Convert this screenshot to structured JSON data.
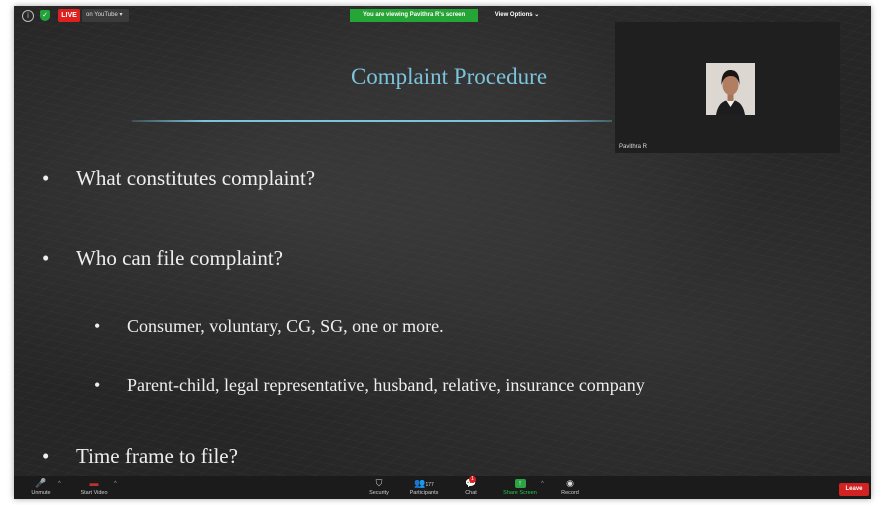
{
  "top_bar": {
    "live_label": "LIVE",
    "youtube_label": "on YouTube ▾",
    "viewing_banner": "You are viewing Pavithra R's screen",
    "view_options": "View Options ⌄"
  },
  "slide": {
    "title": "Complaint Procedure",
    "bullets": [
      "What constitutes complaint?",
      "Who can file complaint?",
      "Consumer, voluntary, CG, SG, one or more.",
      "Parent-child, legal representative, husband, relative, insurance company",
      "Time frame to file?"
    ],
    "bullet_glyph": "•"
  },
  "video_tile": {
    "participant_name": "Pavithra R"
  },
  "toolbar": {
    "unmute": "Unmute",
    "start_video": "Start Video",
    "security": "Security",
    "participants": "Participants",
    "participant_count": "177",
    "chat": "Chat",
    "chat_badge": "1",
    "share_screen": "Share Screen",
    "record": "Record",
    "leave": "Leave"
  },
  "colors": {
    "title": "#7cc3dc",
    "live": "#e0201e",
    "banner": "#24a535",
    "leave": "#d32222"
  }
}
